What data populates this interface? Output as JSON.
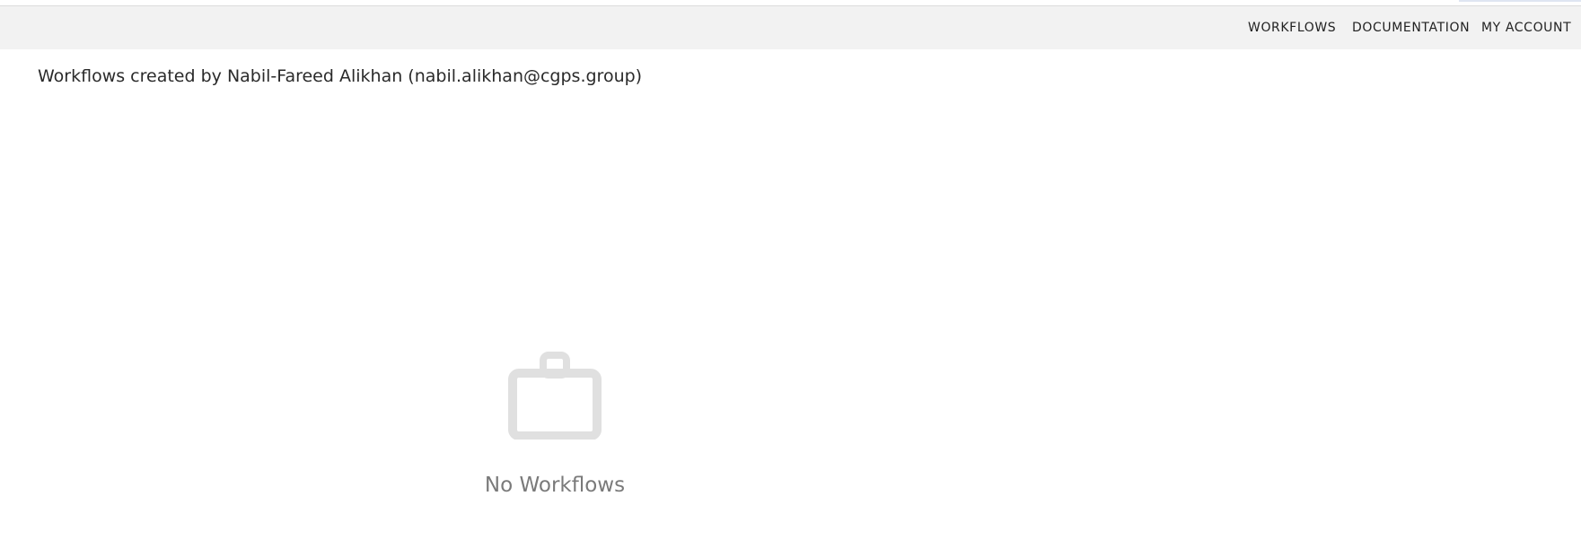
{
  "nav": {
    "items": [
      {
        "label": "WORKFLOWS"
      },
      {
        "label": "DOCUMENTATION"
      },
      {
        "label": "MY ACCOUNT"
      }
    ]
  },
  "page": {
    "heading": "Workflows created by Nabil-Fareed Alikhan (nabil.alikhan@cgps.group)"
  },
  "empty_state": {
    "icon": "briefcase-icon",
    "text": "No Workflows"
  },
  "colors": {
    "navbar_bg": "#f2f2f2",
    "icon": "#e0e0e0",
    "muted_text": "#7a7a7a"
  }
}
